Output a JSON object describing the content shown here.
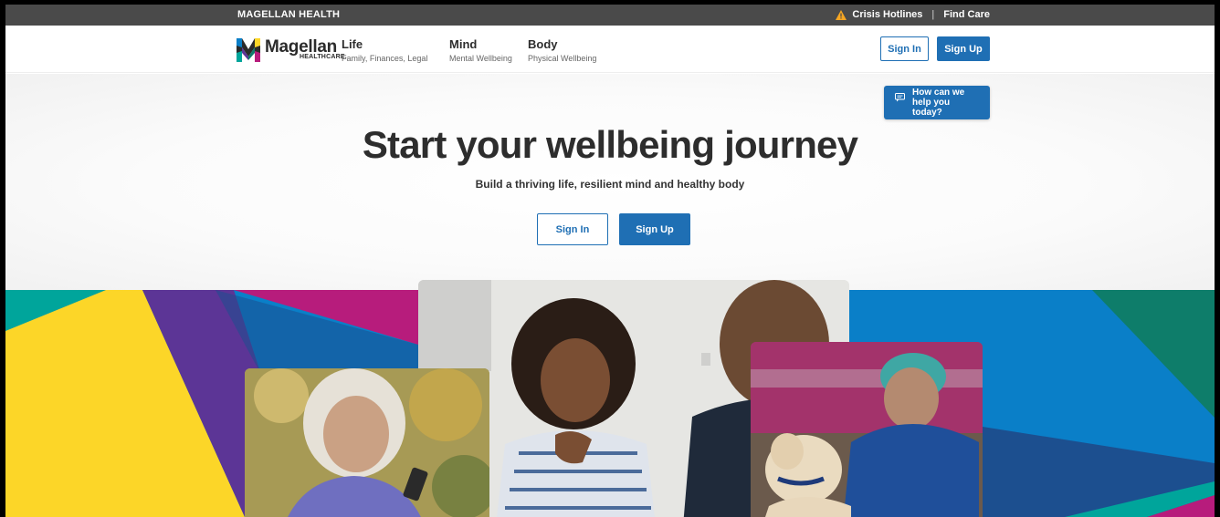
{
  "topbar": {
    "brand": "MAGELLAN HEALTH",
    "crisis_link": "Crisis Hotlines",
    "separator": "|",
    "find_care_link": "Find Care"
  },
  "nav": {
    "logo_name": "Magellan",
    "logo_sub": "HEALTHCARE.",
    "items": [
      {
        "title": "Life",
        "subtitle": "Family, Finances, Legal"
      },
      {
        "title": "Mind",
        "subtitle": "Mental Wellbeing"
      },
      {
        "title": "Body",
        "subtitle": "Physical Wellbeing"
      }
    ],
    "sign_in": "Sign In",
    "sign_up": "Sign Up"
  },
  "help": {
    "label": "How can we help you today?"
  },
  "hero": {
    "title": "Start your wellbeing journey",
    "subtitle": "Build a thriving life, resilient mind and healthy body",
    "sign_in": "Sign In",
    "sign_up": "Sign Up"
  },
  "colors": {
    "primary_blue": "#1f6fb4",
    "topbar_gray": "#4a4a4a",
    "title_text": "#2d2d2d",
    "collage_yellow": "#fcd628",
    "collage_purple": "#5c3596",
    "collage_magenta": "#b71c7c",
    "collage_blue": "#0a7fc8",
    "collage_teal": "#00a59b",
    "collage_green": "#0e7d6a",
    "collage_navy": "#1c4f8f"
  },
  "icons": {
    "warning": "warning-triangle-icon",
    "chat": "chat-bubble-icon",
    "logo": "magellan-m-logo"
  }
}
